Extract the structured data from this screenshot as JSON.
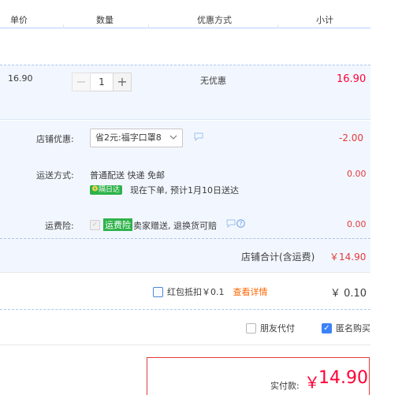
{
  "header": {
    "columns": [
      "单价",
      "数量",
      "优惠方式",
      "小计"
    ]
  },
  "item": {
    "unit_price": "16.90",
    "quantity": "1",
    "minus_symbol": "−",
    "plus_symbol": "+",
    "discount": "无优惠",
    "subtotal": "16.90"
  },
  "shop": {
    "coupon_label": "店铺优惠:",
    "coupon_selected": "省2元:福字口罩8",
    "coupon_amount": "-2.00",
    "shipping_label": "运送方式:",
    "shipping_text": "普通配送 快递 免邮",
    "shipping_badge": "隔日达",
    "shipping_eta": "现在下单, 预计1月10日送达",
    "shipping_amount": "0.00",
    "insurance_label": "运费险:",
    "insurance_tag": "运费险",
    "insurance_text": "卖家赠送, 退换货可赔",
    "insurance_amount": "0.00",
    "total_label": "店铺合计(含运费)",
    "total_value": "￥14.90"
  },
  "redpacket": {
    "label": "红包抵扣￥0.1",
    "details_link": "查看详情",
    "value": "￥ 0.10"
  },
  "options": {
    "friend_pay_label": "朋友代付",
    "anonymous_label": "匿名购买"
  },
  "payment": {
    "label": "实付款:",
    "currency": "￥",
    "amount": "14.90"
  },
  "colors": {
    "accent_red": "#e4393c",
    "price_red": "#ff0036",
    "checkbox_blue": "#3c82f7",
    "badge_green": "#2db24a",
    "link_orange": "#ff6600",
    "row_bg": "#f2f7ff"
  },
  "icons": [
    "chevron-down-icon",
    "chat-icon",
    "lightning-icon",
    "help-icon",
    "check-icon"
  ]
}
